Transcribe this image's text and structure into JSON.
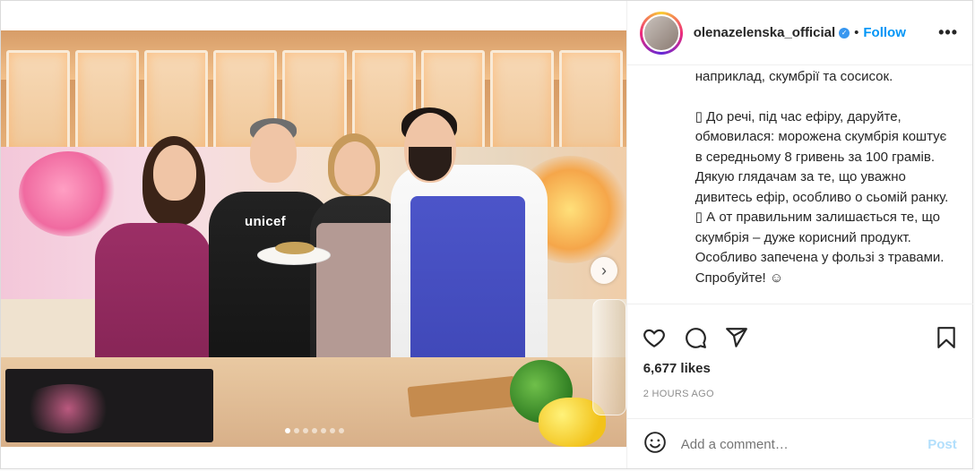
{
  "post": {
    "username": "olenazelenska_official",
    "separator": "•",
    "follow_label": "Follow",
    "more_label": "•••",
    "verified_glyph": "✓",
    "caption_paragraphs": [
      "наприклад, скумбрії та сосисок.",
      "▯ До речі, під час ефіру, даруйте, обмовилася: морожена скумбрія коштує в середньому 8 гривень за 100 грамів. Дякую глядачам за те, що уважно дивитесь ефір, особливо о сьомій ранку. ▯ А от правильним залишається те, що скумбрія – дуже корисний продукт. Особливо запечена у фользі з травами. Спробуйте! ☺"
    ],
    "likes": "6,677 likes",
    "time_ago": "2 HOURS AGO",
    "comment_placeholder": "Add a comment…",
    "post_label": "Post",
    "photo_text": "unicef",
    "carousel": {
      "count": 7,
      "active": 0
    }
  },
  "icons": {
    "like": "heart-icon",
    "comment": "comment-icon",
    "share": "send-icon",
    "save": "bookmark-icon",
    "emoji": "smiley-icon",
    "next": "chevron-right-icon"
  },
  "colors": {
    "link": "#0095f6",
    "post_disabled": "#b2dffc",
    "verified": "#3897f0",
    "muted": "#8e8e8e"
  }
}
